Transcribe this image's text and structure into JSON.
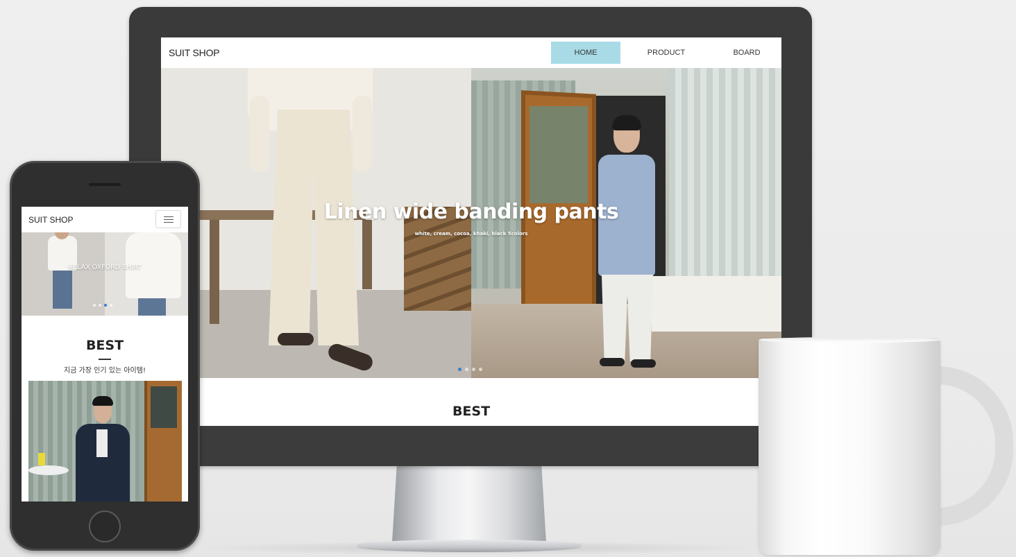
{
  "desktop": {
    "logo": "SUIT SHOP",
    "nav": [
      {
        "label": "HOME",
        "active": true
      },
      {
        "label": "PRODUCT",
        "active": false
      },
      {
        "label": "BOARD",
        "active": false
      }
    ],
    "hero": {
      "title": "Linen wide banding pants",
      "subtitle": "white, cream, cocoa, khaki, black 5colors",
      "active_slide": 1,
      "slide_count": 4
    },
    "best_heading": "BEST"
  },
  "mobile": {
    "logo": "SUIT SHOP",
    "menu_icon": "hamburger-menu-icon",
    "hero": {
      "title": "RELAX OXFORD SHIRT",
      "active_slide": 3,
      "slide_count": 4
    },
    "best_heading": "BEST",
    "best_subtitle": "지금 가장 인기 있는 아이템!"
  },
  "colors": {
    "nav_active": "#a8dbe6",
    "dot_active": "#3a7bd5",
    "device_frame": "#3a3a3a"
  }
}
